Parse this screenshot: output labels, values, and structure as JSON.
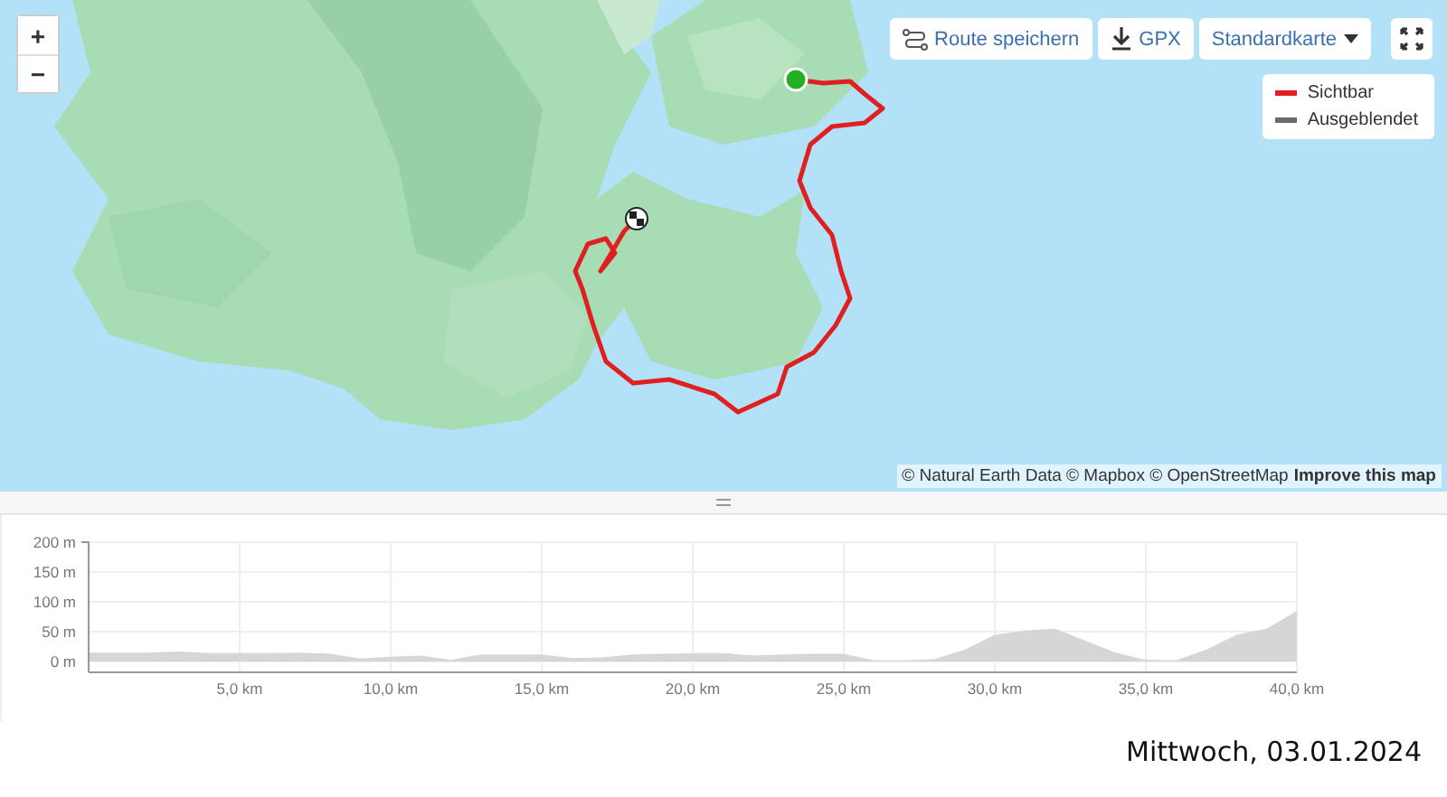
{
  "map": {
    "zoom_in": "+",
    "zoom_out": "−",
    "toolbar": [
      {
        "kind": "save",
        "label": "Route speichern"
      },
      {
        "kind": "download",
        "label": "GPX"
      },
      {
        "kind": "dropdown",
        "label": "Standardkarte"
      },
      {
        "kind": "fullscreen"
      }
    ],
    "legend": [
      {
        "label": "Sichtbar",
        "color": "#e02020"
      },
      {
        "label": "Ausgeblendet",
        "color": "#6b6b6b"
      }
    ],
    "attribution": "© Natural Earth Data © Mapbox © OpenStreetMap",
    "attribution_link": "Improve this map"
  },
  "elevation": {
    "chart_data": {
      "type": "area",
      "grid": true,
      "x": [
        0,
        1,
        2,
        3,
        4,
        5,
        6,
        7,
        8,
        9,
        10,
        11,
        12,
        13,
        14,
        15,
        16,
        17,
        18,
        19,
        20,
        21,
        22,
        23,
        24,
        25,
        26,
        27,
        28,
        29,
        30,
        31,
        32,
        33,
        34,
        35,
        36,
        37,
        38,
        39,
        40
      ],
      "series": [
        {
          "color": "#d6d6d6",
          "values": [
            15,
            15,
            15,
            17,
            14,
            14,
            14,
            15,
            13,
            5,
            8,
            10,
            3,
            12,
            12,
            12,
            6,
            7,
            12,
            13,
            14,
            14,
            10,
            12,
            13,
            13,
            2,
            2,
            4,
            20,
            45,
            52,
            55,
            35,
            15,
            3,
            2,
            20,
            45,
            55,
            85
          ]
        }
      ],
      "xlim": [
        0,
        40
      ],
      "ylim": [
        -18,
        200
      ],
      "xticks": [
        {
          "value": 5,
          "label": "5,0 km"
        },
        {
          "value": 10,
          "label": "10,0 km"
        },
        {
          "value": 15,
          "label": "15,0 km"
        },
        {
          "value": 20,
          "label": "20,0 km"
        },
        {
          "value": 25,
          "label": "25,0 km"
        },
        {
          "value": 30,
          "label": "30,0 km"
        },
        {
          "value": 35,
          "label": "35,0 km"
        },
        {
          "value": 40,
          "label": "40,0 km"
        }
      ],
      "yticks": [
        {
          "value": 0,
          "label": "0 m"
        },
        {
          "value": 50,
          "label": "50 m"
        },
        {
          "value": 100,
          "label": "100 m"
        },
        {
          "value": 150,
          "label": "150 m"
        },
        {
          "value": 200,
          "label": "200 m"
        }
      ]
    }
  },
  "caption": "Mittwoch, 03.01.2024"
}
